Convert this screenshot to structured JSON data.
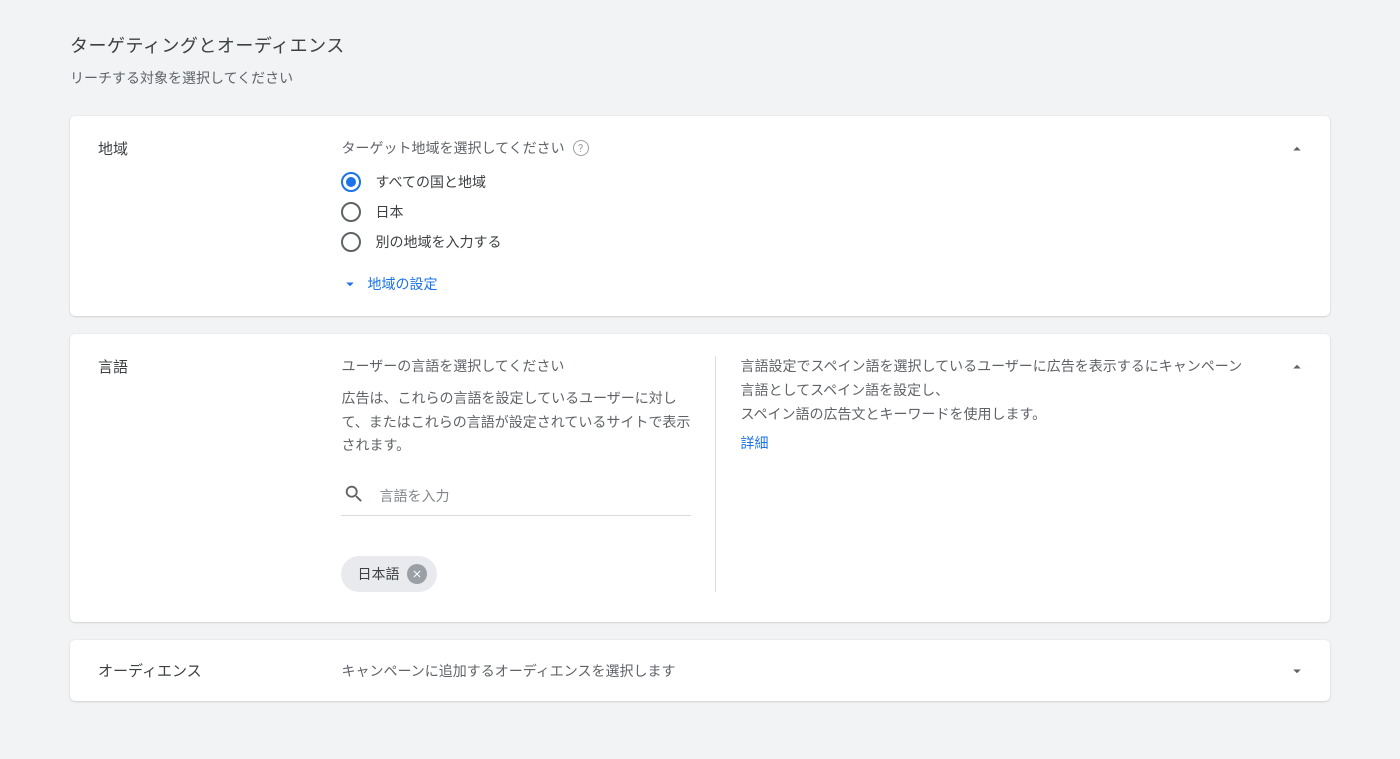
{
  "header": {
    "title": "ターゲティングとオーディエンス",
    "subtitle": "リーチする対象を選択してください"
  },
  "location": {
    "label": "地域",
    "prompt": "ターゲット地域を選択してください",
    "options": {
      "all": "すべての国と地域",
      "japan": "日本",
      "other": "別の地域を入力する"
    },
    "settings_link": "地域の設定"
  },
  "language": {
    "label": "言語",
    "prompt": "ユーザーの言語を選択してください",
    "description": "広告は、これらの言語を設定しているユーザーに対して、またはこれらの言語が設定されているサイトで表示されます。",
    "search_placeholder": "言語を入力",
    "chip": "日本語",
    "hint": {
      "line1": "言語設定でスペイン語を選択しているユーザーに広告を表示するにキャンペーン言語としてスペイン語を設定し、",
      "line2": "スペイン語の広告文とキーワードを使用します。",
      "link": "詳細"
    }
  },
  "audience": {
    "label": "オーディエンス",
    "prompt": "キャンペーンに追加するオーディエンスを選択します"
  }
}
